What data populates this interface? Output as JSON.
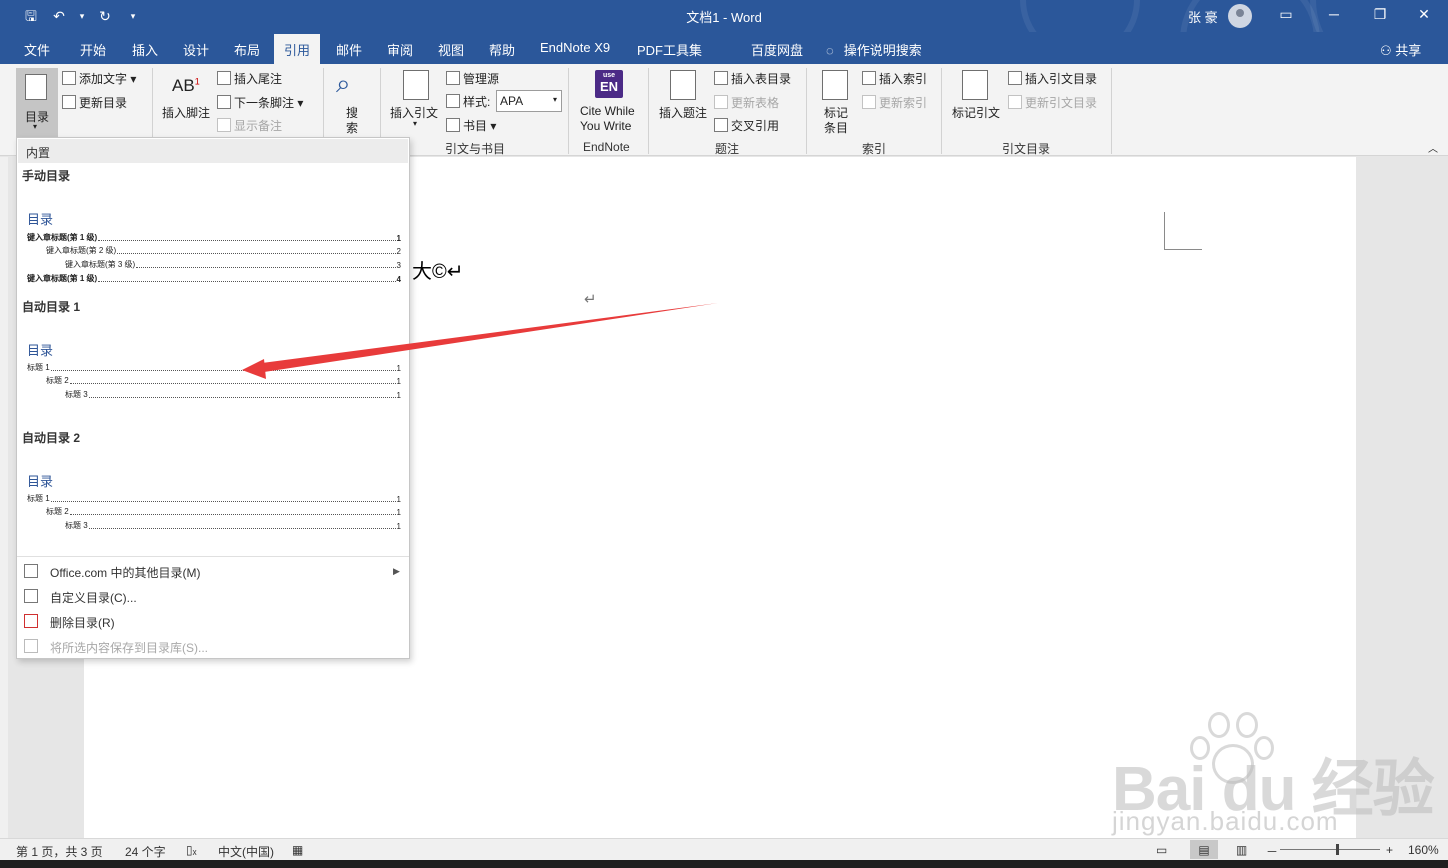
{
  "window": {
    "title": "文档1  -  Word",
    "user": "张 豪",
    "qat": {
      "save": "🖫",
      "undo": "↶",
      "undo_more": "▾",
      "redo": "↻",
      "customize": "▾"
    },
    "controls": {
      "ribbon_options": "▭",
      "minimize": "─",
      "restore": "❐",
      "close": "✕"
    }
  },
  "tabs": [
    "文件",
    "开始",
    "插入",
    "设计",
    "布局",
    "引用",
    "邮件",
    "审阅",
    "视图",
    "帮助",
    "EndNote X9",
    "PDF工具集",
    "百度网盘"
  ],
  "active_tab": "引用",
  "tell_me": "操作说明搜索",
  "share": "共享",
  "ribbon": {
    "toc": {
      "label": "目录",
      "add_text": "添加文字",
      "update": "更新目录"
    },
    "footnotes": {
      "insert_footnote": "插入脚注",
      "insert_endnote": "插入尾注",
      "next_footnote": "下一条脚注",
      "show_notes": "显示备注"
    },
    "search": {
      "label1": "搜",
      "label2": "索"
    },
    "citations": {
      "insert_citation": "插入引文",
      "manage_sources": "管理源",
      "style_label": "样式:",
      "style_value": "APA",
      "bibliography": "书目",
      "group": "引文与书目"
    },
    "endnote": {
      "icon_top": "use",
      "icon_text": "EN",
      "line1": "Cite While",
      "line2": "You Write",
      "group": "EndNote"
    },
    "captions": {
      "insert_caption": "插入题注",
      "insert_table_of_figures": "插入表目录",
      "update_table": "更新表格",
      "cross_reference": "交叉引用",
      "group": "题注"
    },
    "index": {
      "mark_entry1": "标记",
      "mark_entry2": "条目",
      "insert_index": "插入索引",
      "update_index": "更新索引",
      "group": "索引"
    },
    "authorities": {
      "mark_citation": "标记引文",
      "insert_toa": "插入引文目录",
      "update_toa": "更新引文目录",
      "group": "引文目录"
    }
  },
  "dropdown": {
    "header": "内置",
    "manual": {
      "section": "手动目录",
      "title": "目录",
      "lines": [
        {
          "text": "键入章标题(第 1 级)",
          "page": "1"
        },
        {
          "text": "键入章标题(第 2 级)",
          "page": "2"
        },
        {
          "text": "键入章标题(第 3 级)",
          "page": "3"
        },
        {
          "text": "键入章标题(第 1 级)",
          "page": "4"
        }
      ]
    },
    "auto1": {
      "section": "自动目录 1",
      "title": "目录",
      "lines": [
        {
          "text": "标题 1",
          "page": "1"
        },
        {
          "text": "标题 2",
          "page": "1"
        },
        {
          "text": "标题 3",
          "page": "1"
        }
      ]
    },
    "auto2": {
      "section": "自动目录 2",
      "title": "目录",
      "lines": [
        {
          "text": "标题 1",
          "page": "1"
        },
        {
          "text": "标题 2",
          "page": "1"
        },
        {
          "text": "标题 3",
          "page": "1"
        }
      ]
    },
    "menu": {
      "more": "Office.com 中的其他目录(M)",
      "custom": "自定义目录(C)...",
      "remove": "删除目录(R)",
      "save": "将所选内容保存到目录库(S)..."
    }
  },
  "document": {
    "text": "大©↵",
    "para_mark": "↵"
  },
  "status": {
    "page": "第 1 页，共 3 页",
    "words": "24 个字",
    "language": "中文(中国)",
    "zoom": "160%",
    "zoom_minus": "－",
    "zoom_plus": "+"
  },
  "watermark": {
    "brand": "Bai du 经验",
    "url": "jingyan.baidu.com"
  },
  "colors": {
    "accent": "#2b579a",
    "arrow": "#e83b3b",
    "toc_title": "#2e5597"
  }
}
